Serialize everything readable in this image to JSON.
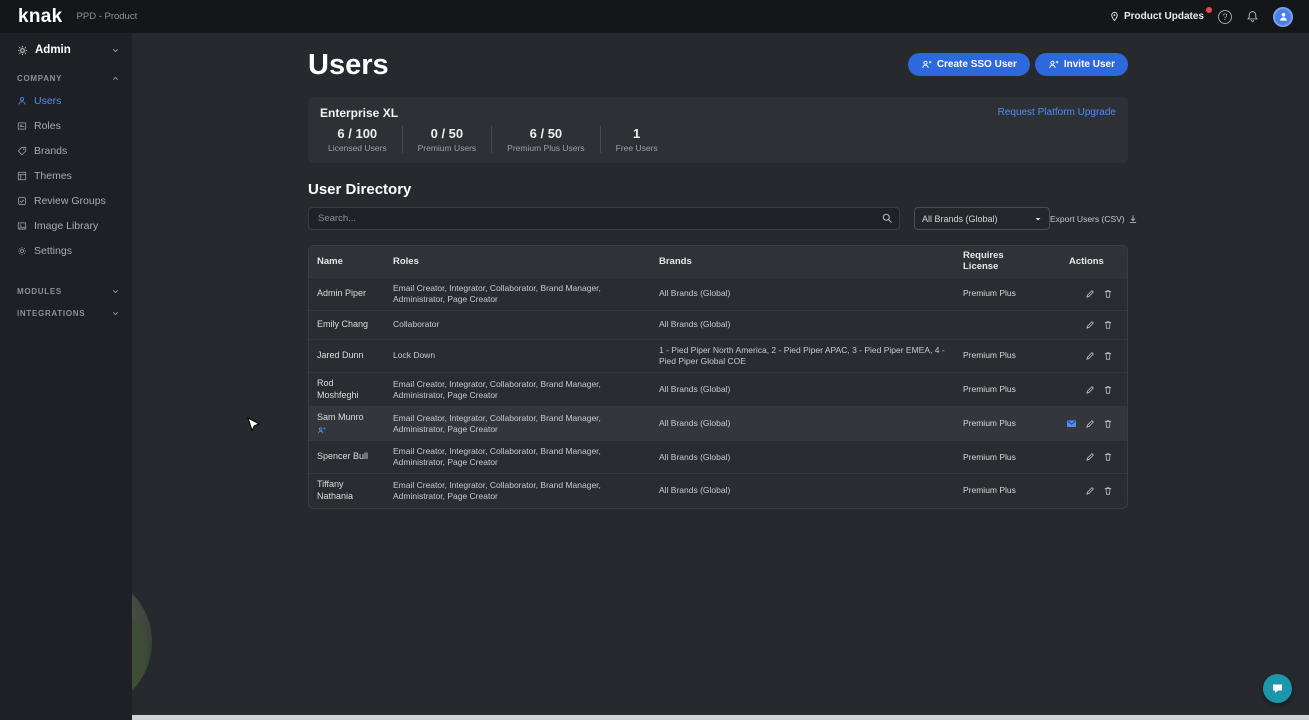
{
  "topbar": {
    "logo": "knak",
    "workspace": "PPD - Product",
    "product_updates": "Product Updates",
    "help": "?"
  },
  "sidebar": {
    "admin": "Admin",
    "company": {
      "label": "COMPANY",
      "items": [
        {
          "label": "Users"
        },
        {
          "label": "Roles"
        },
        {
          "label": "Brands"
        },
        {
          "label": "Themes"
        },
        {
          "label": "Review Groups"
        },
        {
          "label": "Image Library"
        },
        {
          "label": "Settings"
        }
      ]
    },
    "modules_label": "MODULES",
    "integrations_label": "INTEGRATIONS"
  },
  "main": {
    "title": "Users",
    "create_sso_label": "Create SSO User",
    "invite_label": "Invite User",
    "plan": {
      "name": "Enterprise XL",
      "upgrade_link": "Request Platform Upgrade",
      "stats": [
        {
          "value": "6 / 100",
          "label": "Licensed Users"
        },
        {
          "value": "0 / 50",
          "label": "Premium Users"
        },
        {
          "value": "6 / 50",
          "label": "Premium Plus Users"
        },
        {
          "value": "1",
          "label": "Free Users"
        }
      ]
    },
    "directory": {
      "title": "User Directory",
      "search_placeholder": "Search...",
      "brand_filter_value": "All Brands (Global)",
      "export_label": "Export Users (CSV)"
    },
    "table": {
      "headers": [
        "Name",
        "Roles",
        "Brands",
        "Requires License",
        "Actions"
      ],
      "rows": [
        {
          "name": "Admin Piper",
          "roles": "Email Creator, Integrator, Collaborator, Brand Manager, Administrator, Page Creator",
          "brands": "All Brands (Global)",
          "license": "Premium Plus"
        },
        {
          "name": "Emily Chang",
          "roles": "Collaborator",
          "brands": "All Brands (Global)",
          "license": ""
        },
        {
          "name": "Jared Dunn",
          "roles": "Lock Down",
          "brands": "1 - Pied Piper North America, 2 - Pied Piper APAC, 3 - Pied Piper EMEA, 4 - Pied Piper Global COE",
          "license": "Premium Plus"
        },
        {
          "name": "Rod Moshfeghi",
          "roles": "Email Creator, Integrator, Collaborator, Brand Manager, Administrator, Page Creator",
          "brands": "All Brands (Global)",
          "license": "Premium Plus"
        },
        {
          "name": "Sam Munro",
          "roles": "Email Creator, Integrator, Collaborator, Brand Manager, Administrator, Page Creator",
          "brands": "All Brands (Global)",
          "license": "Premium Plus"
        },
        {
          "name": "Spencer Bull",
          "roles": "Email Creator, Integrator, Collaborator, Brand Manager, Administrator, Page Creator",
          "brands": "All Brands (Global)",
          "license": "Premium Plus"
        },
        {
          "name": "Tiffany Nathania",
          "roles": "Email Creator, Integrator, Collaborator, Brand Manager, Administrator, Page Creator",
          "brands": "All Brands (Global)",
          "license": "Premium Plus"
        }
      ]
    }
  },
  "colors": {
    "accent_blue": "#4f8df7",
    "button_blue": "#2e68dd",
    "badge_red": "#e5484d",
    "chat_teal": "#1b96ac",
    "background": "#26292d"
  }
}
